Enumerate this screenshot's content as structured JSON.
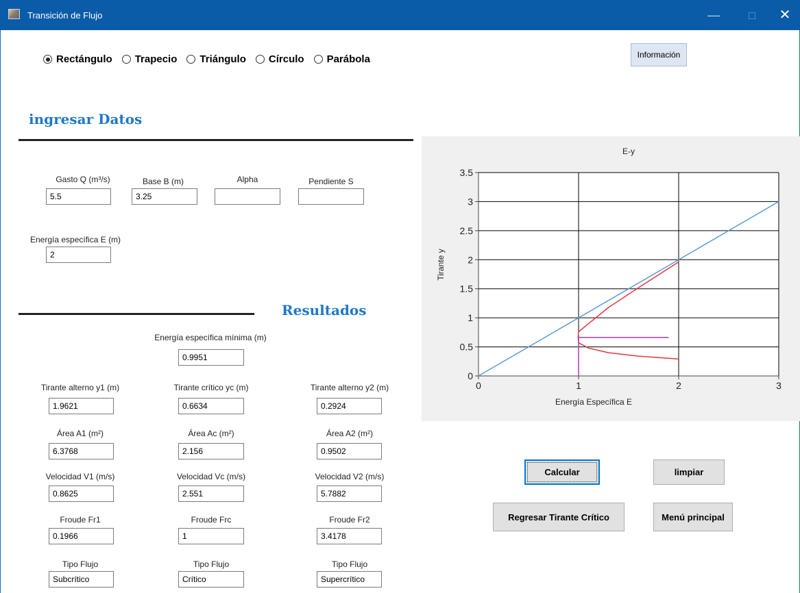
{
  "window": {
    "title": "Transición de Flujo",
    "controls": {
      "minimize": "—",
      "close": "✕"
    }
  },
  "shapes": [
    {
      "label": "Rectángulo",
      "selected": true
    },
    {
      "label": "Trapecio",
      "selected": false
    },
    {
      "label": "Triángulo",
      "selected": false
    },
    {
      "label": "Círculo",
      "selected": false
    },
    {
      "label": "Parábola",
      "selected": false
    }
  ],
  "buttons": {
    "info": "Información",
    "calcular": "Calcular",
    "limpiar": "limpiar",
    "regresar": "Regresar Tirante Crítico",
    "menu": "Menú principal"
  },
  "inputs": {
    "heading": "ingresar Datos",
    "gasto": {
      "label": "Gasto Q (m³/s)",
      "value": "5.5"
    },
    "base": {
      "label": "Base B (m)",
      "value": "3.25"
    },
    "alpha": {
      "label": "Alpha",
      "value": ""
    },
    "pendiente": {
      "label": "Pendiente S",
      "value": ""
    },
    "energia": {
      "label": "Energía específica E (m)",
      "value": "2"
    }
  },
  "results": {
    "heading": "Resultados",
    "emin": {
      "label": "Energía específica mínima (m)",
      "value": "0.9951"
    },
    "y1": {
      "label": "Tirante alterno y1 (m)",
      "value": "1.9621"
    },
    "yc": {
      "label": "Tirante crítico yc (m)",
      "value": "0.6634"
    },
    "y2": {
      "label": "Tirante alterno y2 (m)",
      "value": "0.2924"
    },
    "a1": {
      "label": "Área A1 (m²)",
      "value": "6.3768"
    },
    "ac": {
      "label": "Área Ac (m²)",
      "value": "2.156"
    },
    "a2": {
      "label": "Área A2 (m²)",
      "value": "0.9502"
    },
    "v1": {
      "label": "Velocidad V1 (m/s)",
      "value": "0.8625"
    },
    "vc": {
      "label": "Velocidad Vc (m/s)",
      "value": "2.551"
    },
    "v2": {
      "label": "Velocidad V2 (m/s)",
      "value": "5.7882"
    },
    "fr1": {
      "label": "Froude Fr1",
      "value": "0.1966"
    },
    "frc": {
      "label": "Froude Frc",
      "value": "1"
    },
    "fr2": {
      "label": "Froude Fr2",
      "value": "3.4178"
    },
    "t1": {
      "label": "Tipo Flujo",
      "value": "Subcrítico"
    },
    "tc": {
      "label": "Tipo Flujo",
      "value": "Crítico"
    },
    "t2": {
      "label": "Tipo Flujo",
      "value": "Supercrítico"
    }
  },
  "chart_data": {
    "type": "line",
    "title": "E-y",
    "xlabel": "Energía Específica E",
    "ylabel": "Tirante y",
    "xlim": [
      0,
      3
    ],
    "ylim": [
      0,
      3.5
    ],
    "xticks": [
      "0",
      "1",
      "2",
      "3"
    ],
    "yticks": [
      "0",
      "0.5",
      "1",
      "1.5",
      "2",
      "2.5",
      "3",
      "3.5"
    ],
    "grid": true,
    "series": [
      {
        "color": "#5b9bd5",
        "x": [
          0,
          3
        ],
        "y": [
          0,
          3
        ]
      },
      {
        "color": "#e8343c",
        "x": [
          2,
          1.6,
          1.3,
          1.1,
          1.0,
          0.9951,
          1.0,
          1.1,
          1.3,
          1.6,
          2
        ],
        "y": [
          1.9621,
          1.52,
          1.18,
          0.9,
          0.76,
          0.6634,
          0.57,
          0.48,
          0.4,
          0.34,
          0.2924
        ]
      },
      {
        "color": "#a040b0",
        "x": [
          1,
          1.9
        ],
        "y": [
          0.6634,
          0.6634
        ]
      },
      {
        "color": "#a040b0",
        "x": [
          1,
          1
        ],
        "y": [
          0,
          0.6634
        ]
      }
    ]
  }
}
